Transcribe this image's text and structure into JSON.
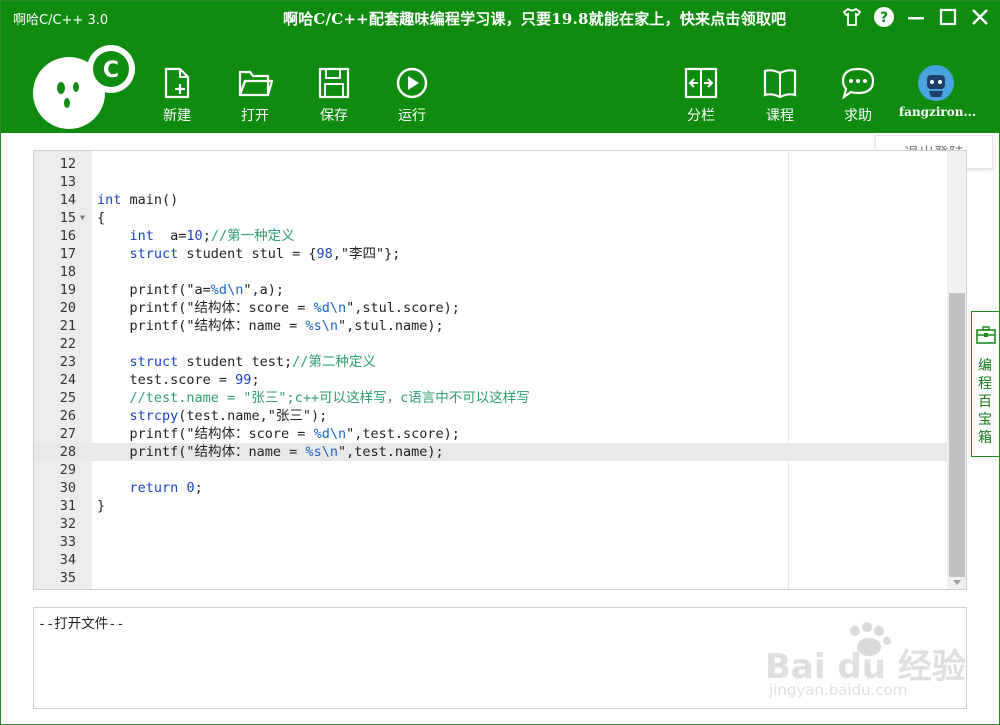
{
  "app": {
    "title": "啊哈C/C++ 3.0"
  },
  "promo": {
    "text": "啊哈C/C++配套趣味编程学习课，只要19.8就能在家上，快来点击领取吧"
  },
  "toolbar": {
    "new_label": "新建",
    "open_label": "打开",
    "save_label": "保存",
    "run_label": "运行",
    "split_label": "分栏",
    "course_label": "课程",
    "help_label": "求助",
    "user_label": "fangziron..."
  },
  "user_menu": {
    "logout_label": "退出登陆"
  },
  "side_tab": {
    "label_1": "编",
    "label_2": "程",
    "label_3": "百",
    "label_4": "宝",
    "label_5": "箱"
  },
  "editor": {
    "lines": [
      {
        "no": "12",
        "text": ""
      },
      {
        "no": "13",
        "text": ""
      },
      {
        "no": "14",
        "text": "int main()"
      },
      {
        "no": "15",
        "text": "{"
      },
      {
        "no": "16",
        "text": "    int  a=10;//第一种定义"
      },
      {
        "no": "17",
        "text": "    struct student stul = {98,\"李四\"};"
      },
      {
        "no": "18",
        "text": ""
      },
      {
        "no": "19",
        "text": "    printf(\"a=%d\\n\",a);"
      },
      {
        "no": "20",
        "text": "    printf(\"结构体：score = %d\\n\",stul.score);"
      },
      {
        "no": "21",
        "text": "    printf(\"结构体：name = %s\\n\",stul.name);"
      },
      {
        "no": "22",
        "text": ""
      },
      {
        "no": "23",
        "text": "    struct student test;//第二种定义"
      },
      {
        "no": "24",
        "text": "    test.score = 99;"
      },
      {
        "no": "25",
        "text": "    //test.name = \"张三\";c++可以这样写，c语言中不可以这样写"
      },
      {
        "no": "26",
        "text": "    strcpy(test.name,\"张三\");"
      },
      {
        "no": "27",
        "text": "    printf(\"结构体：score = %d\\n\",test.score);"
      },
      {
        "no": "28",
        "text": "    printf(\"结构体：name = %s\\n\",test.name);"
      },
      {
        "no": "29",
        "text": ""
      },
      {
        "no": "30",
        "text": "    return 0;"
      },
      {
        "no": "31",
        "text": "}"
      },
      {
        "no": "32",
        "text": ""
      },
      {
        "no": "33",
        "text": ""
      },
      {
        "no": "34",
        "text": ""
      },
      {
        "no": "35",
        "text": ""
      }
    ]
  },
  "output": {
    "text": "--打开文件--"
  },
  "watermark": {
    "brand": "Bai du 经验",
    "url": "jingyan.baidu.com"
  },
  "colors": {
    "header_green": "#0f8c0f",
    "keyword_blue": "#1a44c8",
    "comment_green": "#2e9e6e"
  },
  "icons": [
    "shirt-icon",
    "help-icon",
    "minimize-icon",
    "maximize-icon",
    "close-icon",
    "new-file-icon",
    "open-folder-icon",
    "save-icon",
    "run-icon",
    "split-icon",
    "course-book-icon",
    "chat-help-icon",
    "user-avatar-icon",
    "toolbox-icon"
  ]
}
